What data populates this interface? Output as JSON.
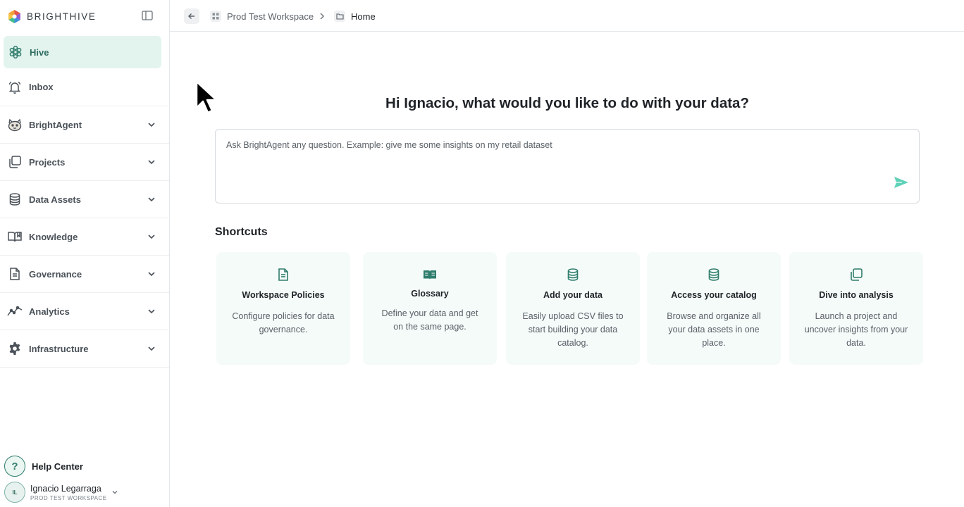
{
  "brand": {
    "name": "BRIGHTHIVE",
    "logo_icon": "brighthive-logo-icon"
  },
  "sidebar": {
    "items": [
      {
        "label": "Hive",
        "icon": "hive-icon",
        "active": true
      },
      {
        "label": "Inbox",
        "icon": "bell-icon"
      },
      {
        "label": "BrightAgent",
        "icon": "agent-icon"
      },
      {
        "label": "Projects",
        "icon": "projects-icon"
      },
      {
        "label": "Data Assets",
        "icon": "database-icon"
      },
      {
        "label": "Knowledge",
        "icon": "book-icon"
      },
      {
        "label": "Governance",
        "icon": "document-icon"
      },
      {
        "label": "Analytics",
        "icon": "analytics-icon"
      },
      {
        "label": "Infrastructure",
        "icon": "gear-icon"
      }
    ],
    "help_label": "Help Center",
    "user": {
      "initials": "IL",
      "name": "Ignacio Legarraga",
      "workspace": "PROD TEST WORKSPACE"
    }
  },
  "breadcrumb": {
    "workspace": "Prod Test Workspace",
    "current": "Home"
  },
  "main": {
    "greeting": "Hi Ignacio, what would you like to do with your data?",
    "prompt_placeholder": "Ask BrightAgent any question. Example: give me some insights on my retail dataset",
    "shortcuts_title": "Shortcuts",
    "cards": [
      {
        "title": "Workspace Policies",
        "desc": "Configure policies for data governance.",
        "icon": "document-icon"
      },
      {
        "title": "Glossary",
        "desc": "Define your data and get on the same page.",
        "icon": "book-open-icon"
      },
      {
        "title": "Add your data",
        "desc": "Easily upload CSV files to start building your data catalog.",
        "icon": "database-icon"
      },
      {
        "title": "Access your catalog",
        "desc": "Browse and organize all your data assets in one place.",
        "icon": "database-icon"
      },
      {
        "title": "Dive into analysis",
        "desc": "Launch a project and uncover insights from your data.",
        "icon": "copy-icon"
      }
    ]
  },
  "colors": {
    "accent": "#2f7d6c",
    "active_bg": "#e3f4ef",
    "send": "#5ed1b8",
    "card_bg": "#f5fbf9"
  }
}
